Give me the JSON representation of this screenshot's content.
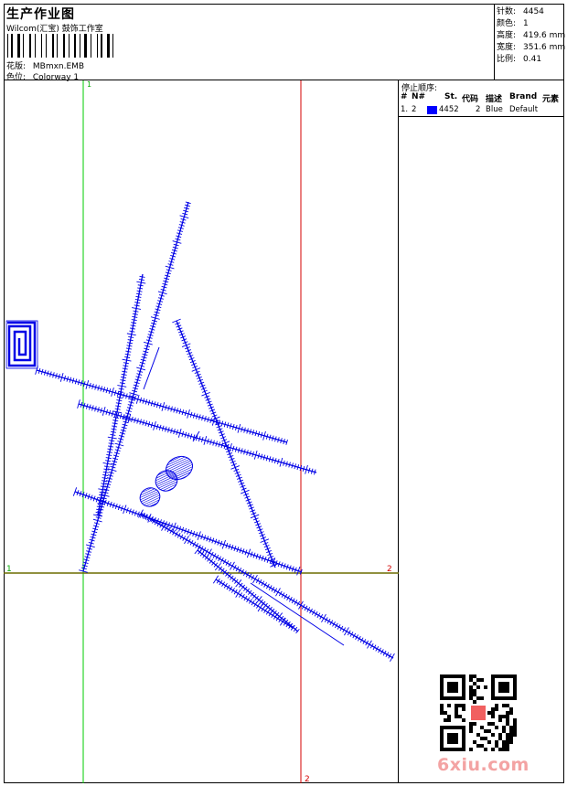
{
  "header": {
    "title": "生产作业图",
    "subtitle": "Wilcom(汇宝) 鼓饰工作室",
    "design_label": "花版:",
    "design_value": "MBmxn.EMB",
    "colorway_label": "色位:",
    "colorway_value": "Colorway 1"
  },
  "stats": [
    {
      "label": "针数:",
      "value": "4454"
    },
    {
      "label": "颜色:",
      "value": "1"
    },
    {
      "label": "高度:",
      "value": "419.6 mm"
    },
    {
      "label": "宽度:",
      "value": "351.6 mm"
    },
    {
      "label": "比例:",
      "value": "0.41"
    }
  ],
  "stop_sequence": {
    "title": "停止顺序:",
    "columns": [
      "#",
      "N#",
      "St.",
      "代码",
      "描述",
      "Brand",
      "元素"
    ],
    "rows": [
      {
        "idx": "1.",
        "n": "2",
        "st": "4452",
        "code": "2",
        "desc": "Blue",
        "brand": "Default",
        "color": "#0000ff"
      }
    ]
  },
  "guides": {
    "v1": "1",
    "h1_left": "1",
    "h1_right": "2",
    "v2": "2"
  },
  "colors": {
    "stitch": "#0000e6",
    "guide_green": "#00cc00",
    "guide_red": "#d40000",
    "guide_olive": "#6b6b00"
  },
  "watermark": "6xiu.com"
}
